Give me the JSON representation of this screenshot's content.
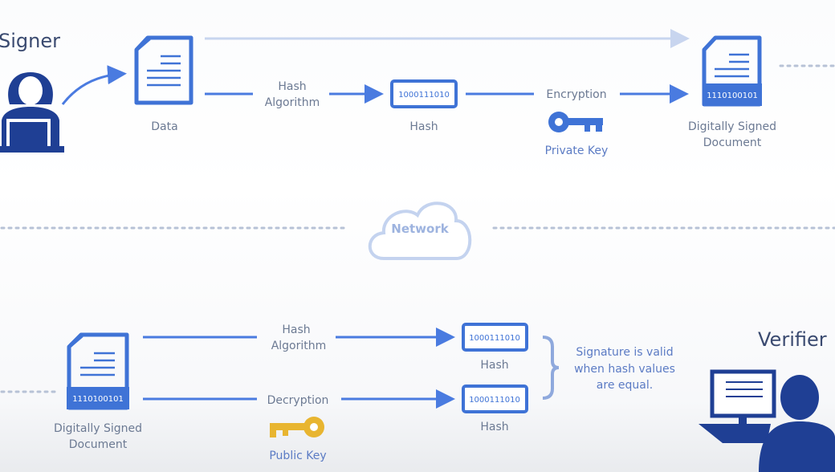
{
  "signer": {
    "title": "Signer"
  },
  "verifier": {
    "title": "Verifier"
  },
  "top": {
    "data_label": "Data",
    "hash_algorithm": [
      "Hash",
      "Algorithm"
    ],
    "hash_value": "1000111010",
    "hash_label": "Hash",
    "encryption_label": "Encryption",
    "private_key_label": "Private Key",
    "signed_doc_bits": "1110100101",
    "signed_doc_label": [
      "Digitally Signed",
      "Document"
    ]
  },
  "network": {
    "label": "Network"
  },
  "bottom": {
    "signed_doc_bits": "1110100101",
    "signed_doc_label": [
      "Digitally Signed",
      "Document"
    ],
    "hash_algorithm": [
      "Hash",
      "Algorithm"
    ],
    "decryption_label": "Decryption",
    "public_key_label": "Public Key",
    "hash1_value": "1000111010",
    "hash1_label": "Hash",
    "hash2_value": "1000111010",
    "hash2_label": "Hash",
    "note": [
      "Signature is valid",
      "when hash values",
      "are equal."
    ]
  },
  "colors": {
    "icon_blue": "#3f73d6",
    "navy": "#1f3f94",
    "key_gold": "#e8b530",
    "text": "#6c7a93"
  }
}
